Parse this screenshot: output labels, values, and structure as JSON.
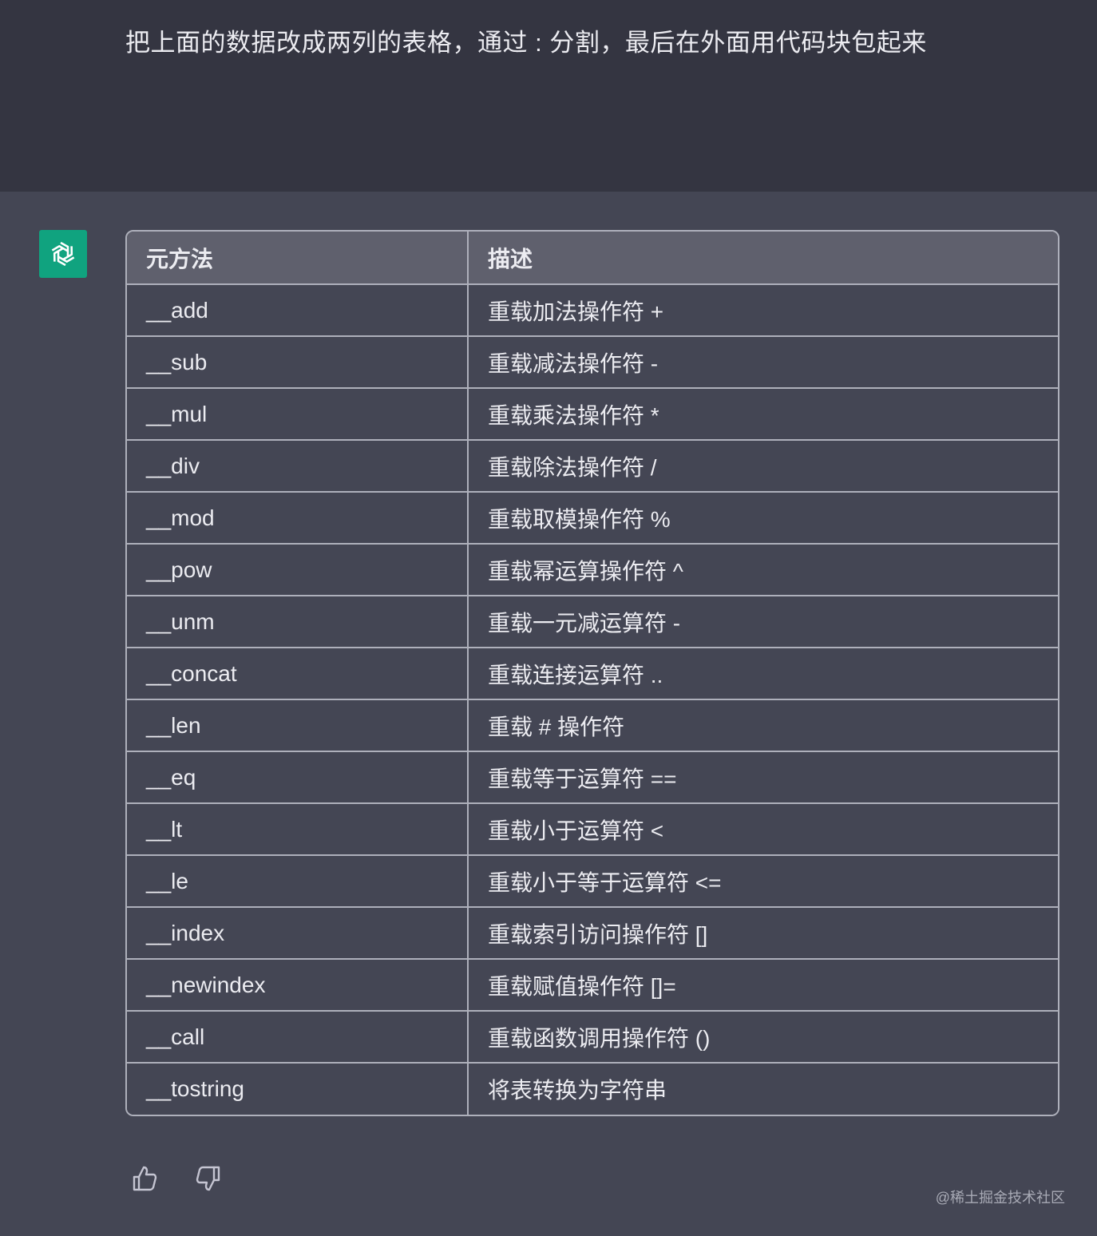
{
  "user_message": {
    "text": "把上面的数据改成两列的表格，通过 : 分割，最后在外面用代码块包起来"
  },
  "assistant": {
    "avatar_icon": "openai-logo-icon",
    "avatar_color": "#10a37f",
    "table": {
      "headers": [
        "元方法",
        "描述"
      ],
      "rows": [
        [
          "__add",
          "重载加法操作符 +"
        ],
        [
          "__sub",
          "重载减法操作符 -"
        ],
        [
          "__mul",
          "重载乘法操作符 *"
        ],
        [
          "__div",
          "重载除法操作符 /"
        ],
        [
          "__mod",
          "重载取模操作符 %"
        ],
        [
          "__pow",
          "重载幂运算操作符 ^"
        ],
        [
          "__unm",
          "重载一元减运算符 -"
        ],
        [
          "__concat",
          "重载连接运算符 .."
        ],
        [
          "__len",
          "重载 # 操作符"
        ],
        [
          "__eq",
          "重载等于运算符 =="
        ],
        [
          "__lt",
          "重载小于运算符 <"
        ],
        [
          "__le",
          "重载小于等于运算符 <="
        ],
        [
          "__index",
          "重载索引访问操作符 []"
        ],
        [
          "__newindex",
          "重载赋值操作符 []="
        ],
        [
          "__call",
          "重载函数调用操作符 ()"
        ],
        [
          "__tostring",
          "将表转换为字符串"
        ]
      ]
    },
    "feedback": {
      "thumb_up_icon": "thumbs-up-icon",
      "thumb_down_icon": "thumbs-down-icon"
    }
  },
  "watermark": "@稀土掘金技术社区",
  "colors": {
    "user_bg": "#343541",
    "assistant_bg": "#444654",
    "table_header_bg": "#5f606d",
    "table_border": "#aeb0bb"
  }
}
